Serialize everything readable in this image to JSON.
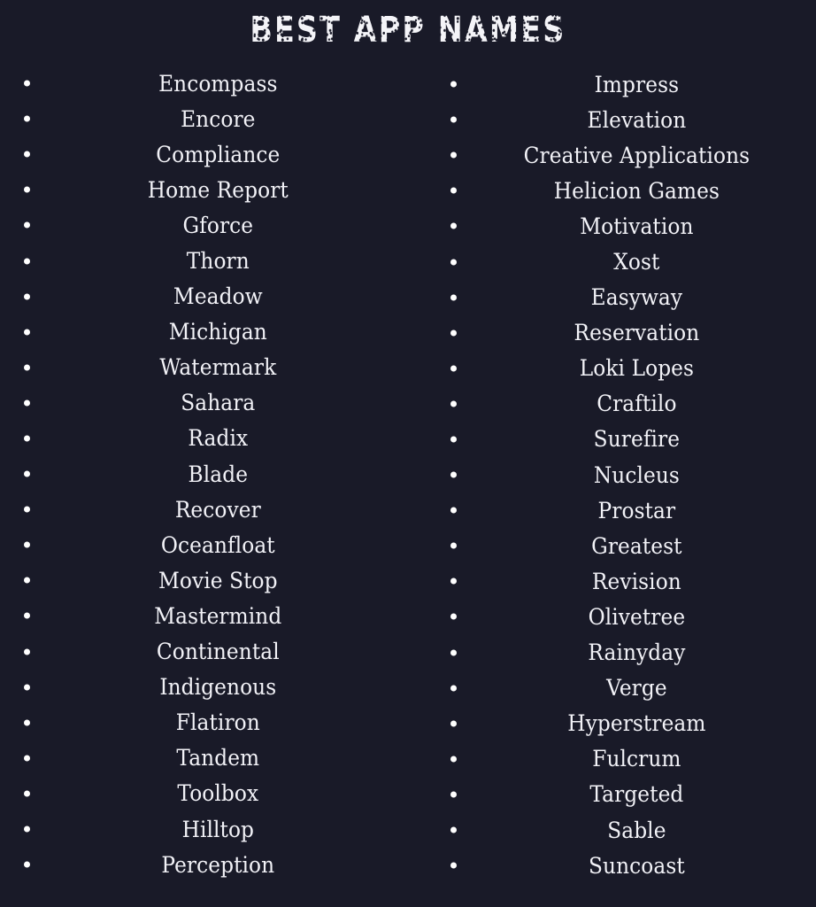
{
  "page": {
    "title": "BEST APP NAMES",
    "background_color": "#191a28",
    "text_color": "#f2f2f7",
    "bullet_color": "#ffffff",
    "title_color": "#f4f4f8"
  },
  "columns": [
    {
      "name": "left-column",
      "items": [
        {
          "label": "Encompass"
        },
        {
          "label": "Encore"
        },
        {
          "label": "Compliance"
        },
        {
          "label": "Home Report"
        },
        {
          "label": "Gforce"
        },
        {
          "label": "Thorn"
        },
        {
          "label": "Meadow"
        },
        {
          "label": "Michigan"
        },
        {
          "label": "Watermark"
        },
        {
          "label": "Sahara"
        },
        {
          "label": "Radix"
        },
        {
          "label": "Blade"
        },
        {
          "label": "Recover"
        },
        {
          "label": "Oceanfloat"
        },
        {
          "label": "Movie Stop"
        },
        {
          "label": "Mastermind"
        },
        {
          "label": "Continental"
        },
        {
          "label": "Indigenous"
        },
        {
          "label": "Flatiron"
        },
        {
          "label": "Tandem"
        },
        {
          "label": "Toolbox"
        },
        {
          "label": "Hilltop"
        },
        {
          "label": "Perception"
        }
      ]
    },
    {
      "name": "right-column",
      "items": [
        {
          "label": "Impress"
        },
        {
          "label": "Elevation"
        },
        {
          "label": "Creative Applications"
        },
        {
          "label": "Helicion Games"
        },
        {
          "label": "Motivation"
        },
        {
          "label": "Xost"
        },
        {
          "label": "Easyway"
        },
        {
          "label": "Reservation"
        },
        {
          "label": "Loki Lopes"
        },
        {
          "label": "Craftilo"
        },
        {
          "label": "Surefire"
        },
        {
          "label": "Nucleus"
        },
        {
          "label": "Prostar"
        },
        {
          "label": "Greatest"
        },
        {
          "label": "Revision"
        },
        {
          "label": "Olivetree"
        },
        {
          "label": "Rainyday"
        },
        {
          "label": "Verge"
        },
        {
          "label": "Hyperstream"
        },
        {
          "label": "Fulcrum"
        },
        {
          "label": "Targeted"
        },
        {
          "label": "Sable"
        },
        {
          "label": "Suncoast"
        }
      ]
    }
  ]
}
